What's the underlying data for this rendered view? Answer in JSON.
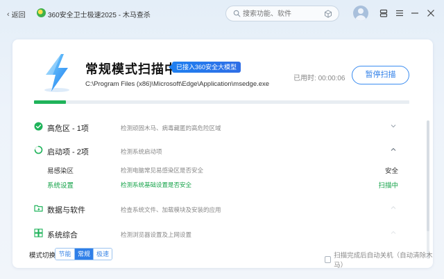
{
  "titlebar": {
    "back_label": "返回",
    "back_icon": "chevron-left-icon",
    "app_title": "360安全卫士极速2025 - 木马查杀",
    "search": {
      "placeholder": "搜索功能、软件"
    }
  },
  "scan": {
    "title": "常规模式扫描中",
    "badge": "已接入360安全大模型",
    "path": "C:\\Program Files (x86)\\Microsoft\\Edge\\Application\\msedge.exe",
    "elapsed_label": "已用时:",
    "elapsed_value": "00:00:06",
    "pause_label": "暂停扫描",
    "progress": 0.085
  },
  "categories": [
    {
      "name": "高危区 - 1项",
      "desc": "检测顽固木马、病毒藏匿的高危险区域",
      "state": "done",
      "icon": "check-circle-icon"
    },
    {
      "name": "启动项 - 2项",
      "desc": "检测系统启动项",
      "state": "scanning",
      "icon": "spinner-icon",
      "items": [
        {
          "name": "易感染区",
          "desc": "检测电脑常见易感染区是否安全",
          "status": "安全"
        },
        {
          "name": "系统设置",
          "desc": "检测系统基础设置是否安全",
          "status": "扫描中"
        }
      ]
    },
    {
      "name": "数据与软件",
      "desc": "检查系统文件、加载模块及安装的应用",
      "state": "pending",
      "icon": "folder-icon"
    },
    {
      "name": "系统综合",
      "desc": "检测浏览器设置及上网设置",
      "state": "pending",
      "icon": "windows-icon"
    }
  ],
  "footer": {
    "mode_label": "模式切换",
    "modes": [
      "节能",
      "常规",
      "极速"
    ],
    "active_mode": "常规",
    "auto_shutdown_label": "扫描完成后自动关机（自动清除木马）"
  },
  "colors": {
    "accent": "#2f7fe8",
    "success": "#16a34a",
    "progress": "#1fb35a"
  }
}
